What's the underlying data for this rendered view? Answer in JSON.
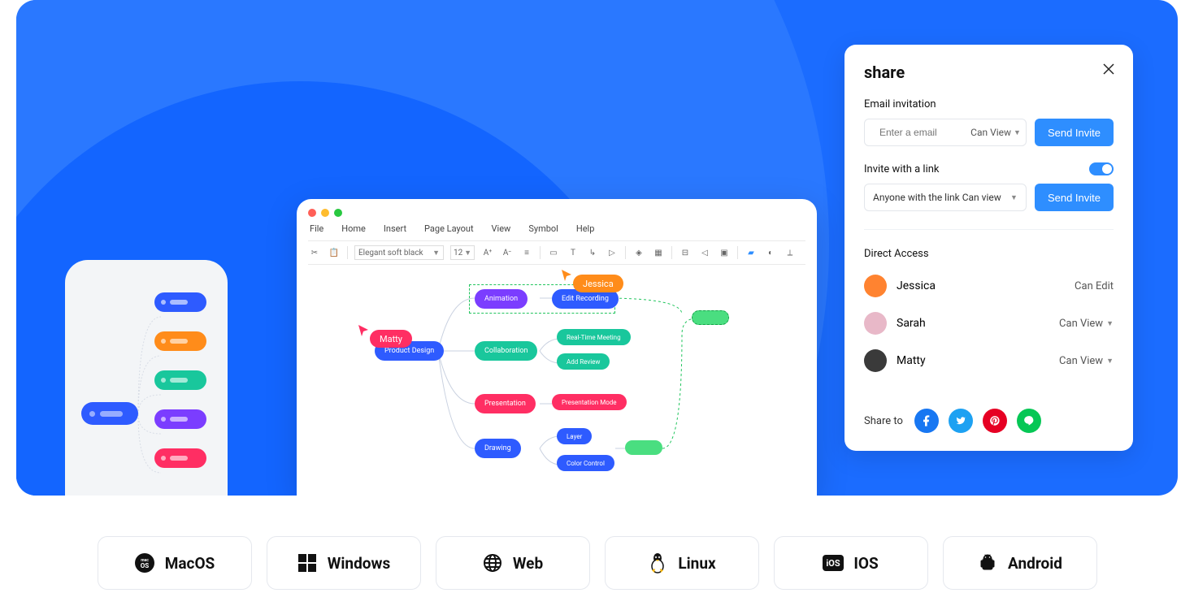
{
  "phone_children_colors": [
    "#2e5bff",
    "#ff8c1a",
    "#19c79c",
    "#7b3dff",
    "#ff2e63"
  ],
  "laptop": {
    "menu": [
      "File",
      "Home",
      "Insert",
      "Page Layout",
      "View",
      "Symbol",
      "Help"
    ],
    "font": "Elegant soft black",
    "font_size": "12"
  },
  "cursors": {
    "jessica": "Jessica",
    "matty": "Matty"
  },
  "mindmap": {
    "root": "Product Design",
    "animation": "Animation",
    "edit_recording": "Edit Recording",
    "collaboration": "Collaboration",
    "real_time": "Real-Time Meeting",
    "add_review": "Add Review",
    "presentation": "Presentation",
    "presentation_mode": "Presentation Mode",
    "drawing": "Drawing",
    "layer": "Layer",
    "color_control": "Color Control"
  },
  "share": {
    "title": "share",
    "email_label": "Email invitation",
    "email_placeholder": "Enter a email",
    "email_perm": "Can View",
    "send": "Send Invite",
    "link_label": "Invite with a link",
    "link_option": "Anyone with the link Can view",
    "direct_label": "Direct Access",
    "people": [
      {
        "name": "Jessica",
        "perm": "Can Edit",
        "dropdown": false,
        "color": "#ff8330"
      },
      {
        "name": "Sarah",
        "perm": "Can View",
        "dropdown": true,
        "color": "#e8b8c8"
      },
      {
        "name": "Matty",
        "perm": "Can View",
        "dropdown": true,
        "color": "#3a3a3a"
      }
    ],
    "share_to": "Share to",
    "socials": [
      {
        "name": "facebook",
        "color": "#1877f2"
      },
      {
        "name": "twitter",
        "color": "#1da1f2"
      },
      {
        "name": "pinterest",
        "color": "#e60023"
      },
      {
        "name": "line",
        "color": "#06c755"
      }
    ]
  },
  "platforms": [
    "MacOS",
    "Windows",
    "Web",
    "Linux",
    "IOS",
    "Android"
  ]
}
